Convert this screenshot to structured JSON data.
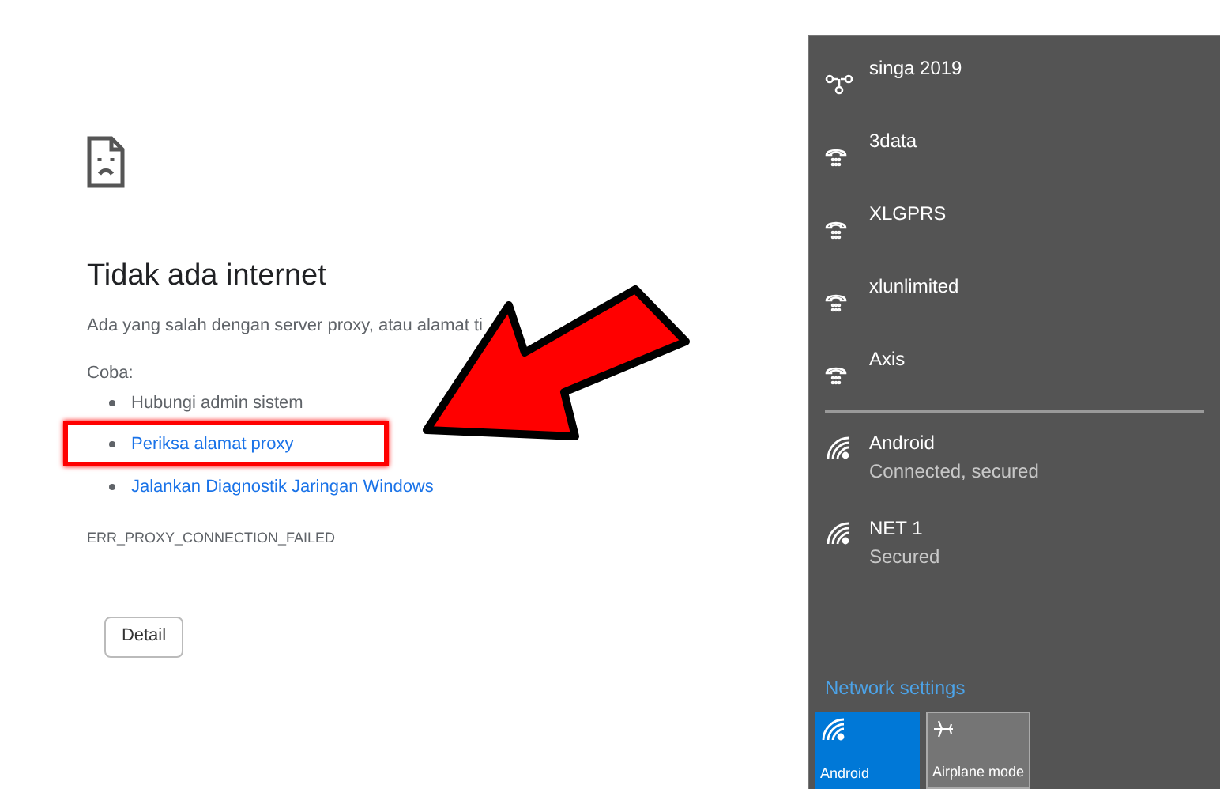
{
  "error_page": {
    "title": "Tidak ada internet",
    "description": "Ada yang salah dengan server proxy, atau alamat ti",
    "try_label": "Coba:",
    "suggestions": [
      {
        "text": "Hubungi admin sistem",
        "kind": "plain"
      },
      {
        "text": "Periksa alamat proxy",
        "kind": "link"
      },
      {
        "text": "Jalankan Diagnostik Jaringan Windows",
        "kind": "link"
      }
    ],
    "error_code": "ERR_PROXY_CONNECTION_FAILED",
    "detail_button": "Detail"
  },
  "network_panel": {
    "networks": [
      {
        "name": "singa 2019",
        "kind": "vpn"
      },
      {
        "name": "3data",
        "kind": "dialup"
      },
      {
        "name": "XLGPRS",
        "kind": "dialup"
      },
      {
        "name": "xlunlimited",
        "kind": "dialup"
      },
      {
        "name": "Axis",
        "kind": "dialup"
      },
      {
        "name": "Android",
        "status": "Connected, secured",
        "kind": "wifi"
      },
      {
        "name": "NET 1",
        "status": "Secured",
        "kind": "wifi"
      }
    ],
    "settings_link": "Network settings",
    "tiles": [
      {
        "label": "Android",
        "kind": "wifi",
        "on": true
      },
      {
        "label": "Airplane mode",
        "kind": "airplane",
        "on": false
      }
    ]
  }
}
